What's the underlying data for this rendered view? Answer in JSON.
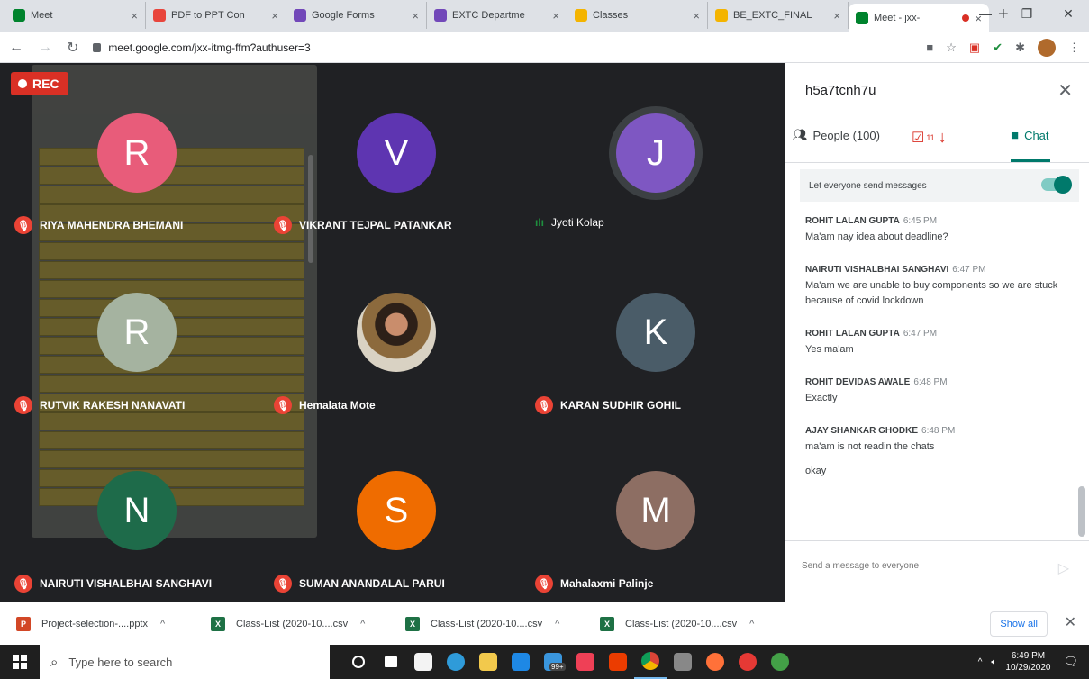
{
  "browser": {
    "tabs": [
      {
        "title": "Meet",
        "color": "#00832d",
        "active": false
      },
      {
        "title": "PDF to PPT Con",
        "color": "#e8453c",
        "active": false
      },
      {
        "title": "Google Forms",
        "color": "#7248b9",
        "active": false
      },
      {
        "title": "EXTC Departme",
        "color": "#7248b9",
        "active": false
      },
      {
        "title": "Classes",
        "color": "#f4b400",
        "active": false
      },
      {
        "title": "BE_EXTC_FINAL",
        "color": "#f4b400",
        "active": false
      },
      {
        "title": "Meet - jxx-",
        "color": "#00832d",
        "active": true
      }
    ],
    "url": "meet.google.com/jxx-itmg-ffm?authuser=3"
  },
  "meet": {
    "rec_label": "REC",
    "participants": [
      {
        "initial": "R",
        "name": "RIYA MAHENDRA BHEMANI",
        "color": "#e85c7a",
        "status": "muted"
      },
      {
        "initial": "V",
        "name": "VIKRANT TEJPAL PATANKAR",
        "color": "#5e35b1",
        "status": "muted"
      },
      {
        "initial": "J",
        "name": "Jyoti Kolap",
        "color": "#7e57c2",
        "status": "speaking"
      },
      {
        "initial": "R",
        "name": "RUTVIK RAKESH NANAVATI",
        "color": "#a5b3a0",
        "status": "muted"
      },
      {
        "initial": "",
        "name": "Hemalata Mote",
        "color": "#8c6a3d",
        "status": "muted"
      },
      {
        "initial": "K",
        "name": "KARAN SUDHIR GOHIL",
        "color": "#4a5c68",
        "status": "muted"
      },
      {
        "initial": "N",
        "name": "NAIRUTI VISHALBHAI SANGHAVI",
        "color": "#1e6b4a",
        "status": "muted"
      },
      {
        "initial": "S",
        "name": "SUMAN ANANDALAL PARUI",
        "color": "#ef6c00",
        "status": "muted"
      },
      {
        "initial": "M",
        "name": "Mahalaxmi Palinje",
        "color": "#8d6e63",
        "status": "muted"
      }
    ]
  },
  "panel": {
    "meeting_code": "h5a7tcnh7u",
    "people_label": "People (100)",
    "tasks_count": "11",
    "chat_label": "Chat",
    "allow_messages_label": "Let everyone send messages",
    "messages": [
      {
        "sender": "ROHIT LALAN GUPTA",
        "time": "6:45 PM",
        "text": "Ma'am nay idea about deadline?"
      },
      {
        "sender": "NAIRUTI VISHALBHAI SANGHAVI",
        "time": "6:47 PM",
        "text": "Ma'am we are unable to buy components so we are stuck because of covid lockdown"
      },
      {
        "sender": "ROHIT LALAN GUPTA",
        "time": "6:47 PM",
        "text": "Yes ma'am"
      },
      {
        "sender": "ROHIT DEVIDAS AWALE",
        "time": "6:48 PM",
        "text": "Exactly"
      },
      {
        "sender": "AJAY SHANKAR GHODKE",
        "time": "6:48 PM",
        "text": "ma'am is not readin the chats"
      }
    ],
    "extra_message": "okay",
    "input_placeholder": "Send a message to everyone"
  },
  "downloads": {
    "items": [
      {
        "name": "Project-selection-....pptx",
        "type": "pptx"
      },
      {
        "name": "Class-List (2020-10....csv",
        "type": "csv"
      },
      {
        "name": "Class-List (2020-10....csv",
        "type": "csv"
      },
      {
        "name": "Class-List (2020-10....csv",
        "type": "csv"
      }
    ],
    "show_all": "Show all"
  },
  "taskbar": {
    "search_placeholder": "Type here to search",
    "badge": "99+",
    "time": "6:49 PM",
    "date": "10/29/2020"
  }
}
